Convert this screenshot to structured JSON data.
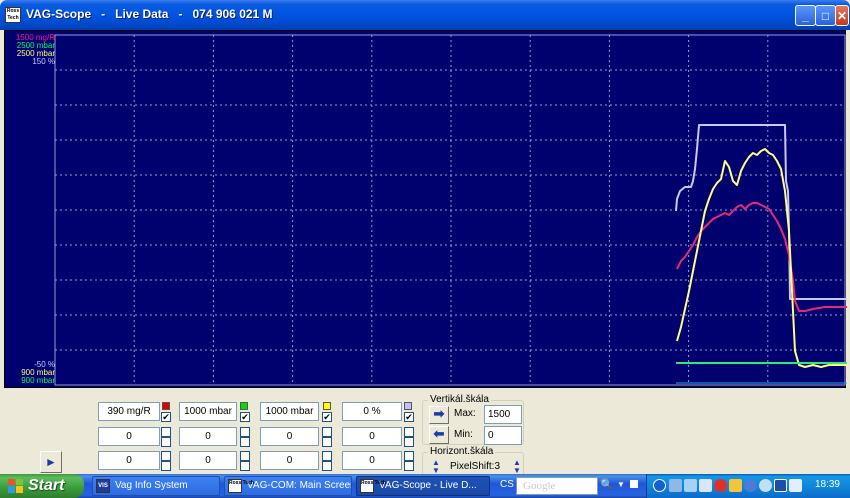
{
  "window": {
    "title": "VAG-Scope   -   Live Data   -   074 906 021 M",
    "app_icon_text": "Ross Tech",
    "buttons": {
      "minimize": "_",
      "maximize": "□",
      "close": "✕"
    }
  },
  "scope": {
    "top_labels": [
      {
        "text": "1500 mg/R",
        "color": "#FF1493"
      },
      {
        "text": "2500 mbar",
        "color": "#00FF66"
      },
      {
        "text": "2500 mbar",
        "color": "#FFFF80"
      },
      {
        "text": "150 %",
        "color": "#C8C8FF"
      }
    ],
    "bottom_labels": [
      {
        "text": "-50 %",
        "color": "#C8C8FF"
      },
      {
        "text": "900 mbar",
        "color": "#FFFF80"
      },
      {
        "text": "900 mbar",
        "color": "#00FF66"
      }
    ],
    "colors": {
      "background": "#00006E",
      "grid": "#9B9BD0",
      "mg_r": "#E8287A",
      "boost_green": "#2EE87A",
      "boost_yellow": "#FFFF80",
      "percent": "#C8C8F0",
      "baseline": "#19B4E0"
    }
  },
  "channels": {
    "row1": [
      {
        "value": "390 mg/R",
        "swatch": "#E00000",
        "checked": "✔"
      },
      {
        "value": "1000 mbar",
        "swatch": "#00E000",
        "checked": "✔"
      },
      {
        "value": "1000 mbar",
        "swatch": "#FFFF00",
        "checked": "✔"
      },
      {
        "value": "0 %",
        "swatch": "#C0C0FF",
        "checked": "✔"
      }
    ],
    "row2": [
      "0",
      "0",
      "0",
      "0"
    ],
    "row3": [
      "0",
      "0",
      "0",
      "0"
    ]
  },
  "vertical_scale": {
    "title": "Vertikál.škála",
    "max_label": "Max:",
    "max_value": "1500",
    "min_label": "Min:",
    "min_value": "0"
  },
  "horizontal_scale": {
    "title": "Horizont.škála",
    "pixelshift": "PixelShift:3"
  },
  "taskbar": {
    "start": "Start",
    "items": [
      {
        "label": "Vag Info System",
        "icon": "VIS"
      },
      {
        "label": "VAG-COM: Main Screen",
        "icon": "Ross Tech"
      },
      {
        "label": "VAG-Scope  -  Live D...",
        "icon": "Ross Tech"
      }
    ],
    "cs_label": "CS",
    "search_placeholder": "Google",
    "clock": "18:39"
  }
}
